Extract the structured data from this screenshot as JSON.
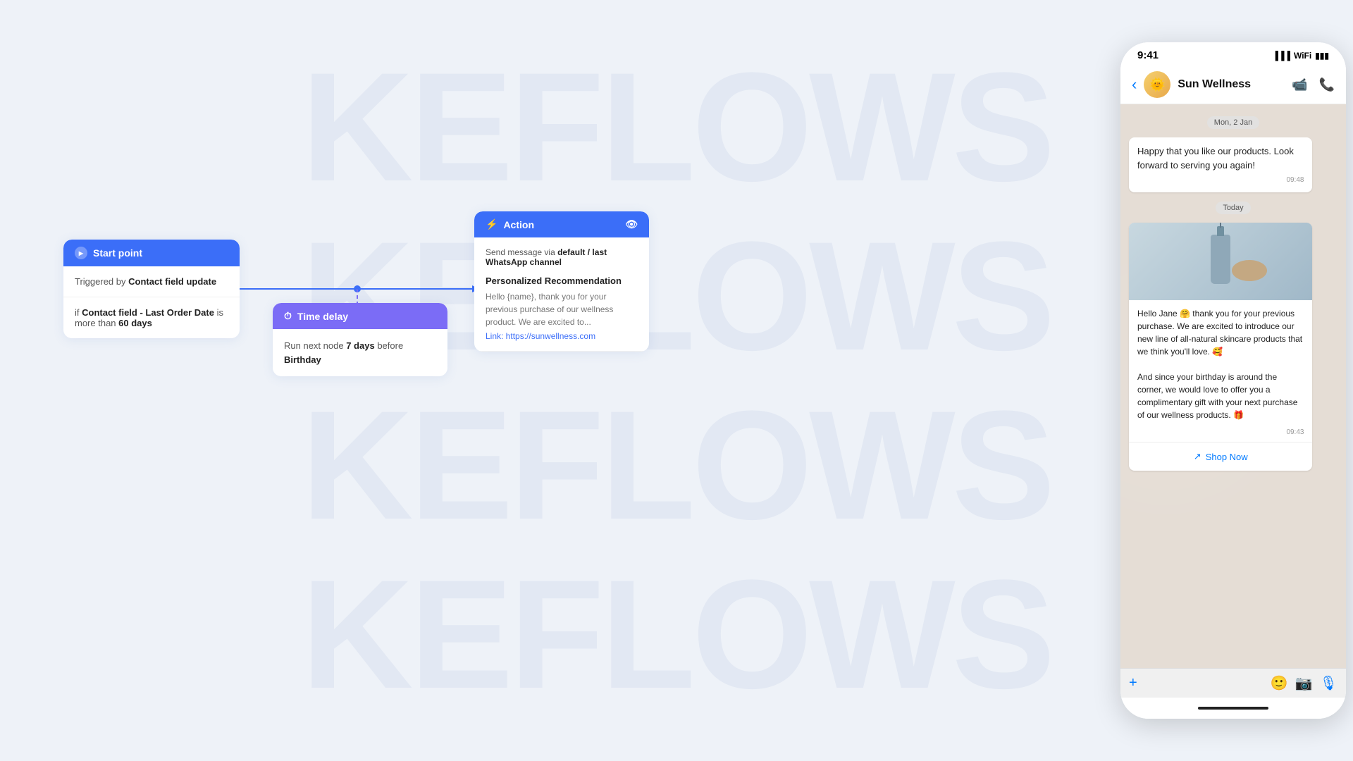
{
  "watermark": {
    "rows": [
      "KEFLOWS",
      "KEFLOWS",
      "KEFLOWS",
      "KEFLOWS"
    ]
  },
  "canvas": {
    "start_node": {
      "header": "Start point",
      "trigger_label": "Triggered by",
      "trigger_value": "Contact field update",
      "condition_prefix": "if",
      "condition_field": "Contact field - Last Order Date",
      "condition_operator": "is more than",
      "condition_value": "60 days"
    },
    "delay_node": {
      "header": "Time delay",
      "body_prefix": "Run next node",
      "body_days": "7 days",
      "body_suffix": "before",
      "body_event": "Birthday"
    },
    "action_node": {
      "header": "Action",
      "send_label": "Send message",
      "send_via": "via",
      "send_channel": "default / last WhatsApp channel",
      "card_title": "Personalized Recommendation",
      "card_body": "Hello {name}, thank you for your previous purchase of our wellness product. We are excited to...",
      "card_link": "Link: https://sunwellness.com"
    }
  },
  "phone": {
    "status_time": "9:41",
    "contact_name": "Sun Wellness",
    "date_badge_1": "Mon, 2 Jan",
    "date_badge_2": "Today",
    "bubble_1": {
      "text": "Happy that you like our products. Look forward to serving you again!",
      "time": "09:48"
    },
    "bubble_2": {
      "text": "Hello Jane 🤗 thank you for your previous purchase. We are excited to introduce our new line of all-natural skincare products that we think you'll love. 🥰\n\nAnd since your birthday is around the corner, we would love to offer you a complimentary gift with your next purchase of our wellness products. 🎁",
      "time": "09:43"
    },
    "shop_now": "Shop Now",
    "input_placeholder": ""
  }
}
